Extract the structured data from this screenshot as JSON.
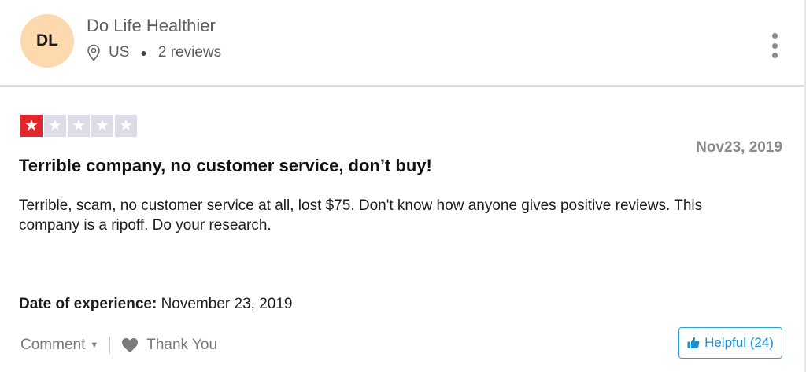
{
  "reviewer": {
    "initials": "DL",
    "name": "Do Life Healthier",
    "country": "US",
    "reviews": "2 reviews"
  },
  "review": {
    "rating": 1,
    "max_rating": 5,
    "date": "Nov23, 2019",
    "title": "Terrible company, no customer service, don’t buy!",
    "body": "Terrible, scam, no customer service at all, lost $75. Don't know how anyone gives positive reviews. This company is a ripoff. Do your research.",
    "experience_label": "Date of experience:",
    "experience_date": "November 23, 2019"
  },
  "actions": {
    "comment_label": "Comment",
    "thank_you_label": "Thank You",
    "helpful_label": "Helpful (24)"
  },
  "colors": {
    "avatar_bg": "#fdd9b0",
    "star_filled": "#e4272d",
    "star_empty": "#dcdce6",
    "helpful_accent": "#1f8fc6"
  },
  "icons": {
    "location": "location-pin-icon",
    "more": "kebab-menu-icon",
    "comment_caret": "caret-down-icon",
    "thank_you": "heart-icon",
    "helpful": "thumbs-up-icon",
    "rating": "star-icon"
  }
}
